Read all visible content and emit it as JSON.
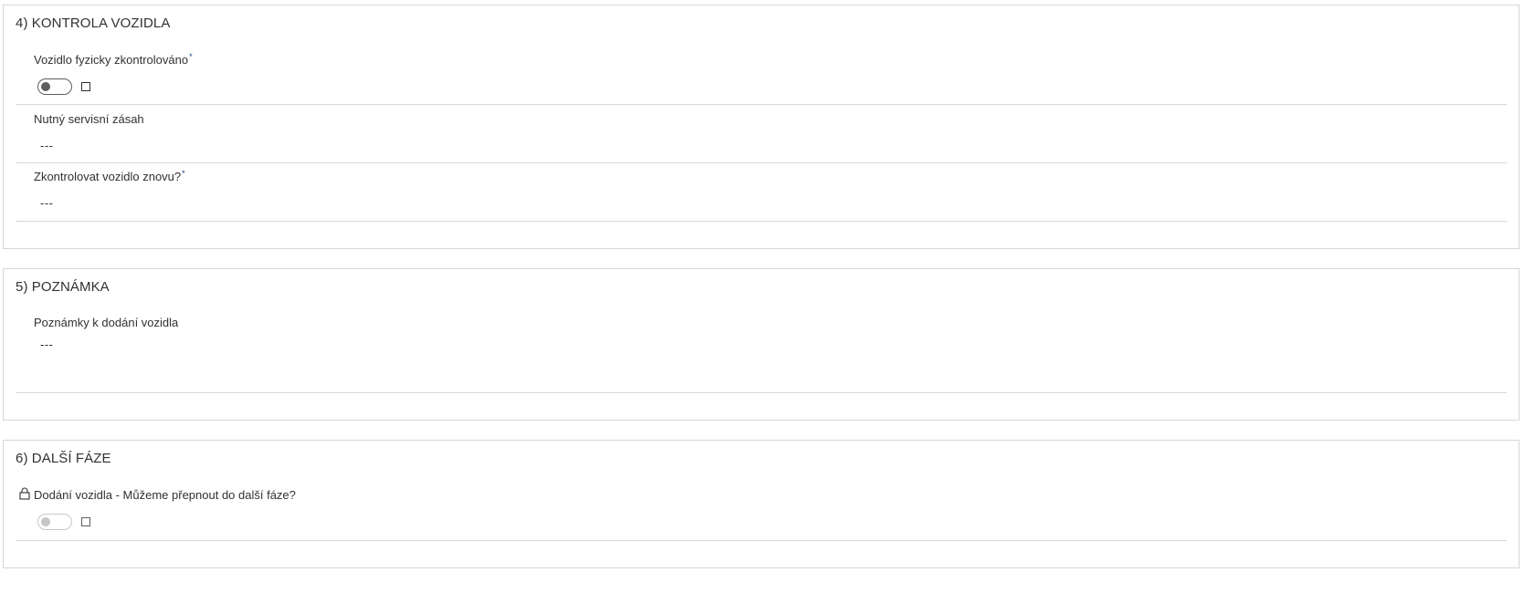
{
  "section_kontrola": {
    "title": "4) KONTROLA VOZIDLA",
    "field_checked": {
      "label": "Vozidlo fyzicky zkontrolováno",
      "required_mark": "*",
      "value": false
    },
    "field_service": {
      "label": "Nutný servisní zásah",
      "value": "---"
    },
    "field_recheck": {
      "label": "Zkontrolovat vozidlo znovu?",
      "required_mark": "*",
      "value": "---"
    }
  },
  "section_poznamka": {
    "title": "5) POZNÁMKA",
    "field_notes": {
      "label": "Poznámky k dodání vozidla",
      "value": "---"
    }
  },
  "section_dalsi_faze": {
    "title": "6) DALŠÍ FÁZE",
    "field_next_phase": {
      "label": "Dodání vozidla - Můžeme přepnout do další fáze?",
      "locked": true,
      "value": false
    }
  },
  "colors": {
    "required_accent": "#1f3d8a",
    "border": "#d6d6d6",
    "text": "#323130"
  },
  "icons": {
    "lock": "lock-icon"
  }
}
